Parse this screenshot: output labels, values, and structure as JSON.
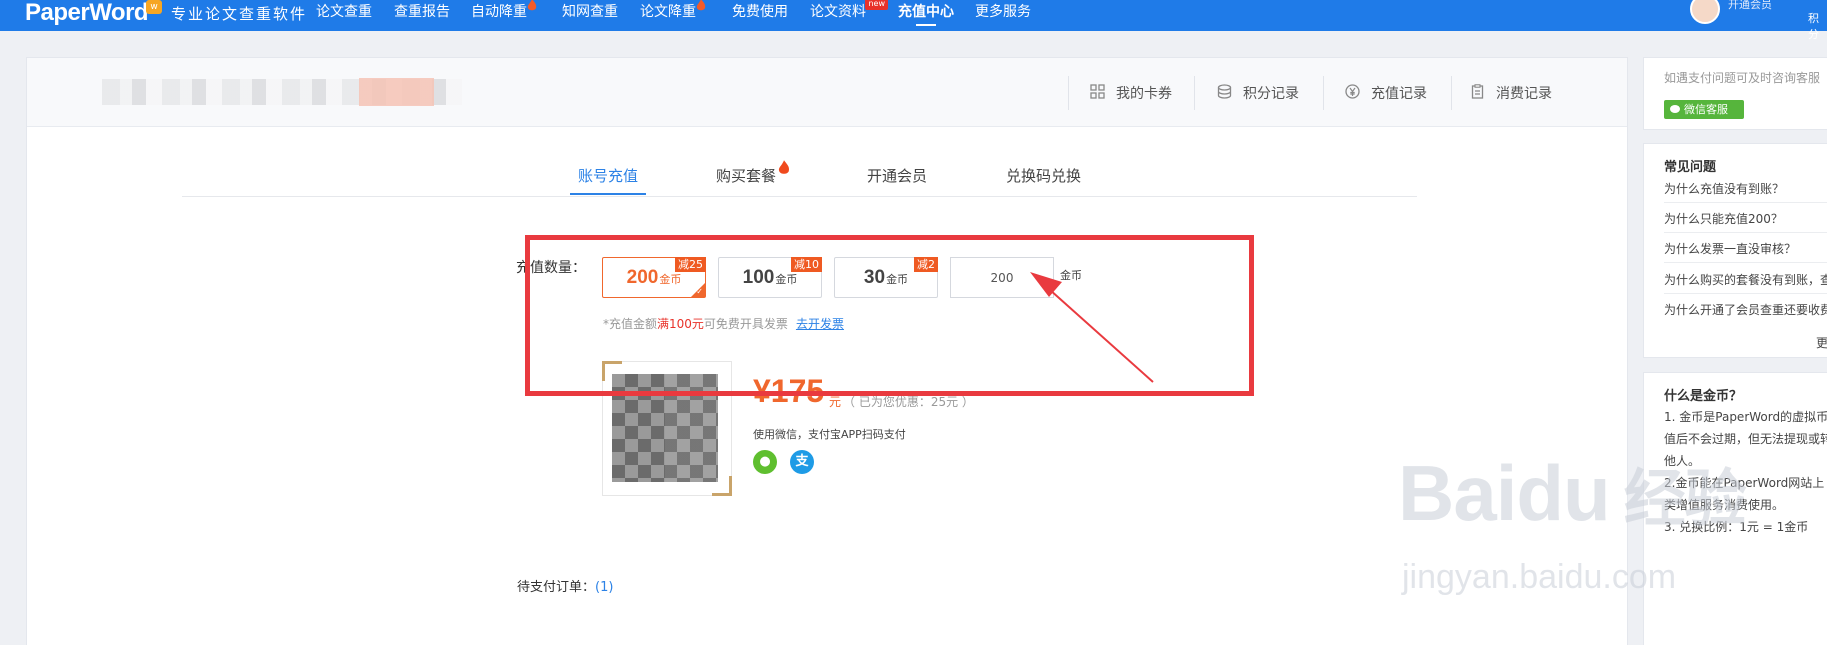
{
  "nav": {
    "logo": "PaperWord",
    "logo_badge": "w",
    "slogan": "专业论文查重软件",
    "items": [
      {
        "label": "论文查重"
      },
      {
        "label": "查重报告"
      },
      {
        "label": "自动降重"
      },
      {
        "label": "知网查重"
      },
      {
        "label": "论文降重"
      },
      {
        "label": "免费使用"
      },
      {
        "label": "论文资料"
      },
      {
        "label": "充值中心"
      },
      {
        "label": "更多服务"
      }
    ],
    "new_badge": "new",
    "user_line1": "开通会员",
    "user_line2": "积分"
  },
  "header_links": [
    {
      "label": "我的卡券",
      "icon": "grid-icon"
    },
    {
      "label": "积分记录",
      "icon": "coins-icon"
    },
    {
      "label": "充值记录",
      "icon": "yen-icon"
    },
    {
      "label": "消费记录",
      "icon": "receipt-icon"
    }
  ],
  "tabs": [
    {
      "label": "账号充值"
    },
    {
      "label": "购买套餐"
    },
    {
      "label": "开通会员"
    },
    {
      "label": "兑换码兑换"
    }
  ],
  "recharge": {
    "label": "充值数量：",
    "options": [
      {
        "amount": "200",
        "unit": "金币",
        "discount": "减25"
      },
      {
        "amount": "100",
        "unit": "金币",
        "discount": "减10"
      },
      {
        "amount": "30",
        "unit": "金币",
        "discount": "减2"
      }
    ],
    "custom_value": "200",
    "custom_unit": "金币",
    "note_prefix": "*充值金额",
    "note_highlight": "满100元",
    "note_suffix": "可免费开具发票",
    "invoice_link": "去开发票",
    "price": "¥175",
    "price_unit": "元",
    "saved": "（ 已为您优惠：25元 ）",
    "pay_tip": "使用微信，支付宝APP扫码支付",
    "pending_label": "待支付订单：",
    "pending_count": "(1)"
  },
  "side": {
    "tip": "如遇支付问题可及时咨询客服",
    "wechat_btn": "微信客服",
    "faq_title": "常见问题",
    "faqs": [
      "为什么充值没有到账？",
      "为什么只能充值200？",
      "为什么发票一直没审核？",
      "为什么购买的套餐没有到账，查",
      "为什么开通了会员查重还要收费"
    ],
    "more": "更",
    "gold_title": "什么是金币？",
    "gold_lines": [
      "1. 金币是PaperWord的虚拟币",
      "值后不会过期，但无法提现或转",
      "他人。",
      "2.金币能在PaperWord网站上",
      "类增值服务消费使用。",
      "3. 兑换比例：1元 = 1金币"
    ]
  },
  "watermark": {
    "brand": "Baidu",
    "brand_cn": "经验",
    "url": "jingyan.baidu.com"
  },
  "colors": {
    "nav_bg": "#1f7be8",
    "accent_orange": "#f0672d",
    "highlight_red": "#e93a3f",
    "link_blue": "#2c82e6"
  }
}
